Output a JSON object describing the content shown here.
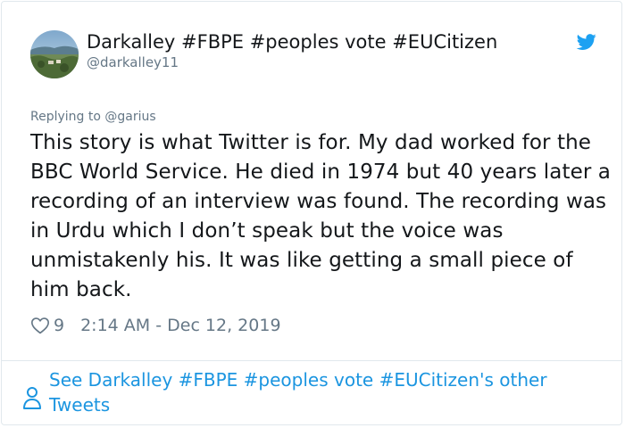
{
  "user": {
    "display_name": "Darkalley #FBPE #peoples vote #EUCitizen",
    "handle": "@darkalley11"
  },
  "reply": {
    "text": "Replying to @garius"
  },
  "tweet": {
    "text": "This story is what Twitter is for. My dad worked for the BBC World Service. He died in 1974 but 40 years later a recording of an interview was found. The recording was in Urdu which I don’t speak but the voice was unmistakenly his. It was like getting a small piece of him back."
  },
  "meta": {
    "like_count": "9",
    "timestamp": "2:14 AM - Dec 12, 2019"
  },
  "footer": {
    "link_text": "See Darkalley #FBPE #peoples vote #EUCitizen's other Tweets"
  },
  "icons": {
    "brand": "twitter-bird-icon",
    "like": "heart-icon",
    "profile": "person-icon"
  },
  "colors": {
    "text": "#14171a",
    "secondary": "#657786",
    "link": "#1b95e0",
    "border": "#e1e8ed"
  }
}
